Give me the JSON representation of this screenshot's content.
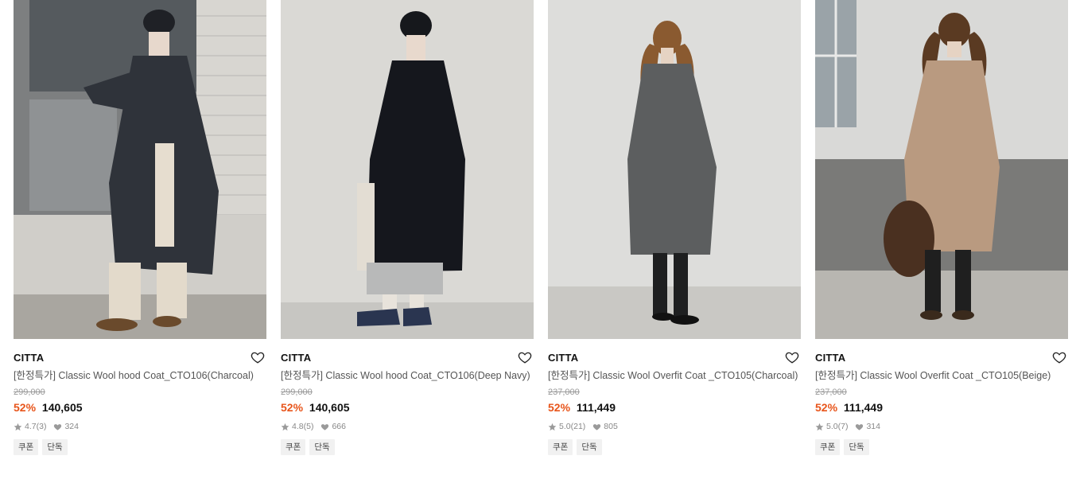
{
  "products": [
    {
      "brand": "CITTA",
      "title": "[한정특가] Classic Wool hood Coat_CTO106(Charcoal)",
      "original_price": "299,000",
      "discount": "52%",
      "price": "140,605",
      "rating": "4.7",
      "review_count": "(3)",
      "likes": "324",
      "badges": [
        "쿠폰",
        "단독"
      ],
      "image": {
        "scene": "outdoor-siding",
        "coat_color": "#2f333a",
        "bg": "#c9c7c2"
      }
    },
    {
      "brand": "CITTA",
      "title": "[한정특가] Classic Wool hood Coat_CTO106(Deep Navy)",
      "original_price": "299,000",
      "discount": "52%",
      "price": "140,605",
      "rating": "4.8",
      "review_count": "(5)",
      "likes": "666",
      "badges": [
        "쿠폰",
        "단독"
      ],
      "image": {
        "scene": "studio",
        "coat_color": "#15171d",
        "bg": "#d9d8d4"
      }
    },
    {
      "brand": "CITTA",
      "title": "[한정특가] Classic Wool Overfit Coat _CTO105(Charcoal)",
      "original_price": "237,000",
      "discount": "52%",
      "price": "111,449",
      "rating": "5.0",
      "review_count": "(21)",
      "likes": "805",
      "badges": [
        "쿠폰",
        "단독"
      ],
      "image": {
        "scene": "studio",
        "coat_color": "#5c5e5f",
        "bg": "#dcdcda"
      }
    },
    {
      "brand": "CITTA",
      "title": "[한정특가] Classic Wool Overfit Coat _CTO105(Beige)",
      "original_price": "237,000",
      "discount": "52%",
      "price": "111,449",
      "rating": "5.0",
      "review_count": "(7)",
      "likes": "314",
      "badges": [
        "쿠폰",
        "단독"
      ],
      "image": {
        "scene": "wall-window",
        "coat_color": "#b99a80",
        "bg": "#d6d6d4"
      }
    }
  ],
  "colors": {
    "discount": "#e8551b",
    "muted": "#999999",
    "badge_bg": "#f1f1f1"
  },
  "icons": {
    "wishlist": "heart-outline-icon",
    "rating": "star-icon",
    "likes": "heart-filled-icon"
  }
}
